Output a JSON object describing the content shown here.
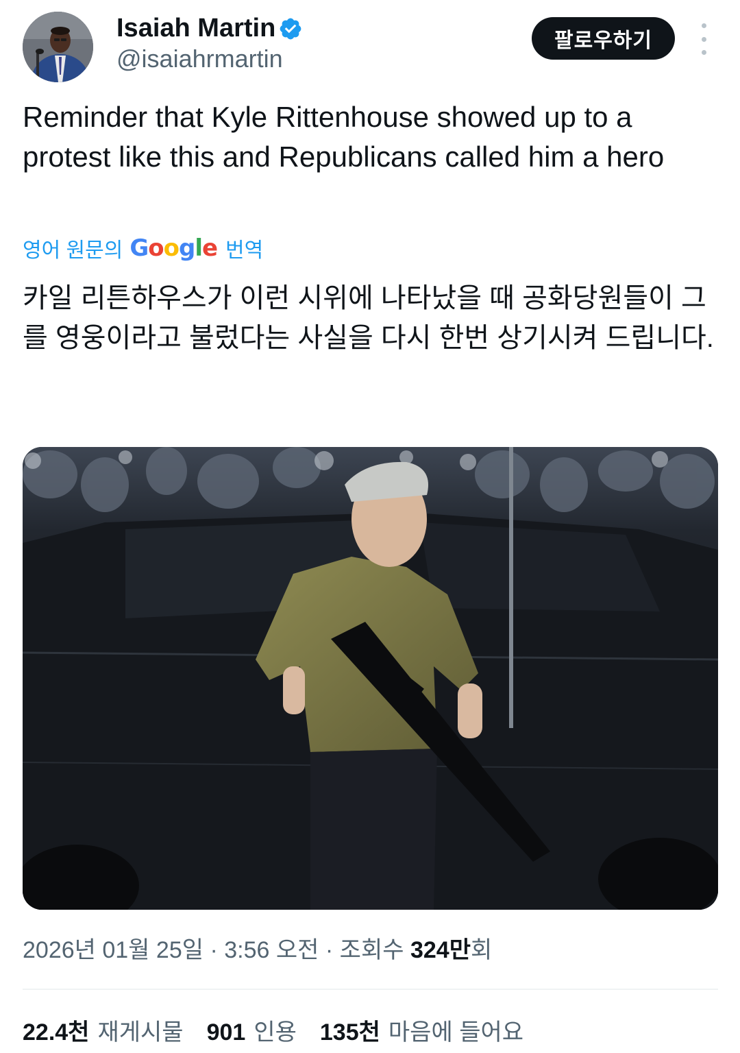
{
  "author": {
    "display_name": "Isaiah Martin",
    "handle": "@isaiahrmartin",
    "verified_icon": "verified-badge-icon",
    "accent": "#1d9bf0"
  },
  "header": {
    "follow_label": "팔로우하기",
    "more_icon": "more-vertical-icon"
  },
  "tweet": {
    "text": "Reminder that Kyle Rittenhouse showed up to a protest like this and Republicans called him a hero",
    "translate": {
      "prefix": "영어 원문의",
      "logo_letters": [
        "G",
        "o",
        "o",
        "g",
        "l",
        "e"
      ],
      "suffix": "번역"
    },
    "translated_text": "카일 리튼하우스가 이런 시위에 나타났을 때 공화당원들이 그를 영웅이라고 불렀다는 사실을 다시 한번 상기시켜 드립니다.",
    "meta": {
      "date": "2026년 01월 25일",
      "separator": "·",
      "time": "3:56 오전",
      "views_label": "조회수",
      "views_value": "324만",
      "views_suffix": "회"
    }
  },
  "stats": [
    {
      "value": "22.4천",
      "label": "재게시물"
    },
    {
      "value": "901",
      "label": "인용"
    },
    {
      "value": "135천",
      "label": "마음에 들어요"
    }
  ]
}
